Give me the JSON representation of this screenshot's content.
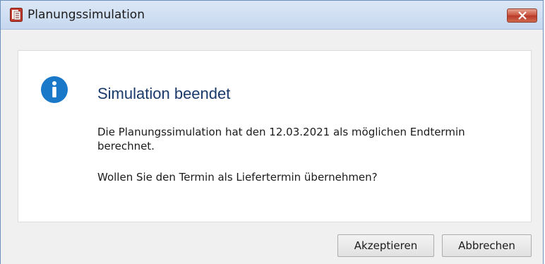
{
  "window": {
    "title": "Planungssimulation"
  },
  "dialog": {
    "heading": "Simulation beendet",
    "message": "Die Planungssimulation hat den 12.03.2021 als möglichen Endtermin berechnet.",
    "question": "Wollen Sie den Termin als Liefertermin übernehmen?",
    "icon": "info-icon",
    "accent_color": "#1a78c9",
    "heading_color": "#1a3a6b"
  },
  "buttons": {
    "accept_label": "Akzeptieren",
    "cancel_label": "Abbrechen"
  }
}
